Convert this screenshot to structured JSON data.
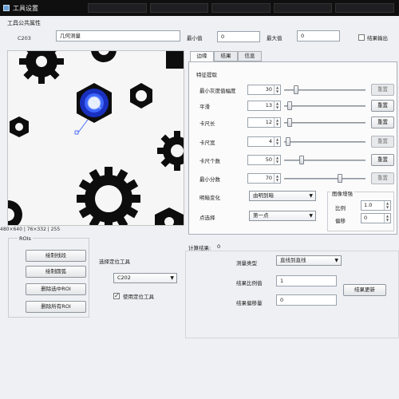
{
  "window": {
    "title": "工具设置"
  },
  "tool_properties": {
    "section_label": "工具公共属性",
    "code": "C203",
    "name": "几何测量",
    "min_label": "最小值",
    "min_value": "0",
    "max_label": "最大值",
    "max_value": "0",
    "output_label": "结果输出",
    "output_checked": false
  },
  "image_status": "480×640 | 76×332 | 255",
  "roi": {
    "label": "ROIs",
    "buttons": [
      "绘制线段",
      "绘制圆弧",
      "删除选中ROI",
      "删除所有ROI"
    ]
  },
  "locate": {
    "label": "选择定位工具",
    "selected": "C202",
    "use_label": "使用定位工具",
    "use_checked": true
  },
  "tabs": [
    "边缘",
    "结果",
    "信息"
  ],
  "active_tab": 0,
  "feature": {
    "label": "特征提取",
    "reset_label": "重置",
    "rows": [
      {
        "label": "最小灰度值幅度",
        "value": "30",
        "reset_enabled": false,
        "level": 0.12
      },
      {
        "label": "平滑",
        "value": "13",
        "reset_enabled": true,
        "level": 0.04
      },
      {
        "label": "卡尺长",
        "value": "12",
        "reset_enabled": true,
        "level": 0.04
      },
      {
        "label": "卡尺宽",
        "value": "4",
        "reset_enabled": false,
        "level": 0.02
      },
      {
        "label": "卡尺个数",
        "value": "50",
        "reset_enabled": true,
        "level": 0.2
      },
      {
        "label": "最小分数",
        "value": "70",
        "reset_enabled": false,
        "level": 0.7
      }
    ],
    "transition_label": "明暗变化",
    "transition_value": "由明到暗",
    "select_label": "点选择",
    "select_value": "第一点"
  },
  "image_enhance": {
    "label": "图像增强",
    "ratio_label": "比例",
    "ratio_value": "1.0",
    "offset_label": "偏移",
    "offset_value": "0"
  },
  "calc": {
    "label": "计算结果:",
    "value": "0",
    "measure_type_label": "测量类型",
    "measure_type_value": "直线到直线",
    "ratio_label": "结果比例值",
    "ratio_value": "1",
    "offset_label": "结果偏移量",
    "offset_value": "0",
    "update_button": "结果更新"
  }
}
